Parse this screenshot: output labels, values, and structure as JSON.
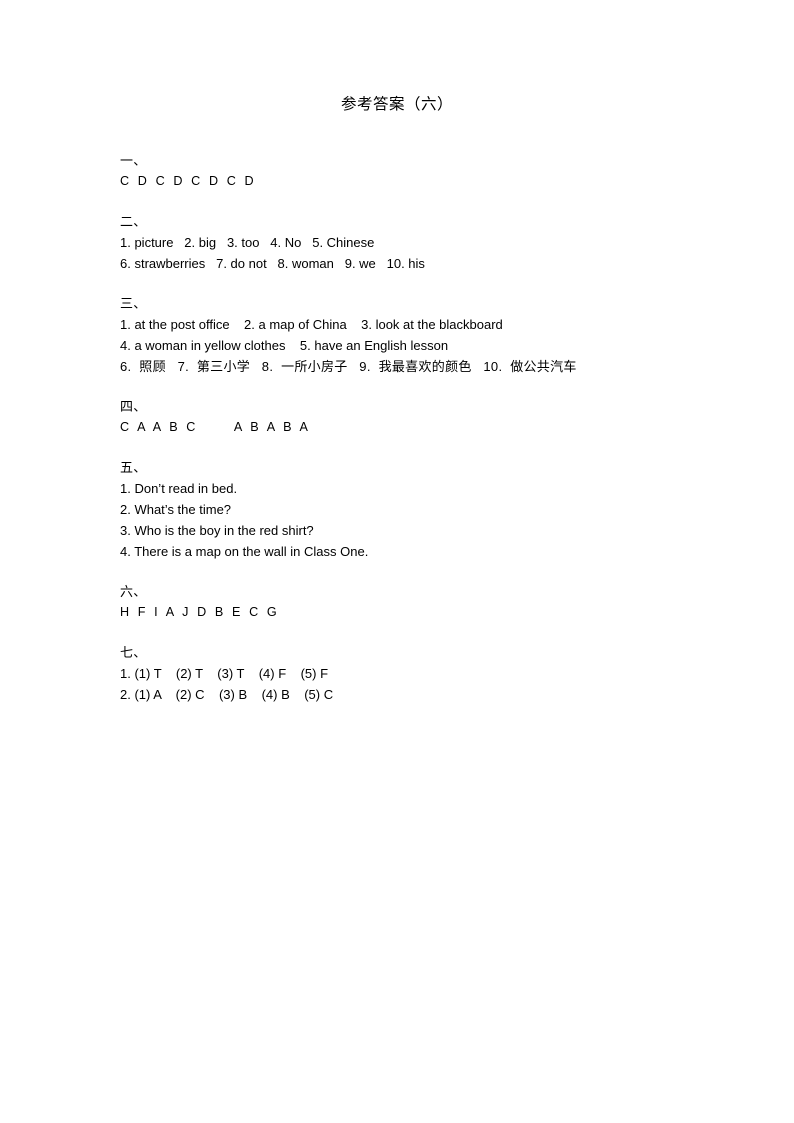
{
  "document": {
    "title": "参考答案（六）",
    "sections": [
      {
        "marker": "一、",
        "name": "section-one",
        "lines": [
          {
            "style": "letters",
            "text": "C D C D C D C D"
          }
        ]
      },
      {
        "marker": "二、",
        "name": "section-two",
        "lines": [
          {
            "style": "text",
            "text": "1. picture   2. big   3. too   4. No   5. Chinese"
          },
          {
            "style": "text",
            "text": "6. strawberries   7. do not   8. woman   9. we   10. his"
          }
        ]
      },
      {
        "marker": "三、",
        "name": "section-three",
        "lines": [
          {
            "style": "text",
            "text": "1. at the post office    2. a map of China    3. look at the blackboard"
          },
          {
            "style": "text",
            "text": "4. a woman in yellow clothes    5. have an English lesson"
          },
          {
            "style": "cn",
            "text": "6.  照顾   7.  第三小学   8.  一所小房子   9.  我最喜欢的颜色   10.  做公共汽车"
          }
        ]
      },
      {
        "marker": "四、",
        "name": "section-four",
        "lines": [
          {
            "style": "letters",
            "text": "C A A B C      A B A B A"
          }
        ]
      },
      {
        "marker": "五、",
        "name": "section-five",
        "lines": [
          {
            "style": "text",
            "text": "1. Don’t read in bed."
          },
          {
            "style": "text",
            "text": "2. What’s the time?"
          },
          {
            "style": "text",
            "text": "3. Who is the boy in the red shirt?"
          },
          {
            "style": "text",
            "text": "4. There is a map on the wall in Class One."
          }
        ]
      },
      {
        "marker": "六、",
        "name": "section-six",
        "lines": [
          {
            "style": "letters",
            "text": "H F I A J D B E C G"
          }
        ]
      },
      {
        "marker": "七、",
        "name": "section-seven",
        "lines": [
          {
            "style": "text",
            "text": "1. (1) T    (2) T    (3) T    (4) F    (5) F"
          },
          {
            "style": "text",
            "text": "2. (1) A    (2) C    (3) B    (4) B    (5) C"
          }
        ]
      }
    ]
  }
}
